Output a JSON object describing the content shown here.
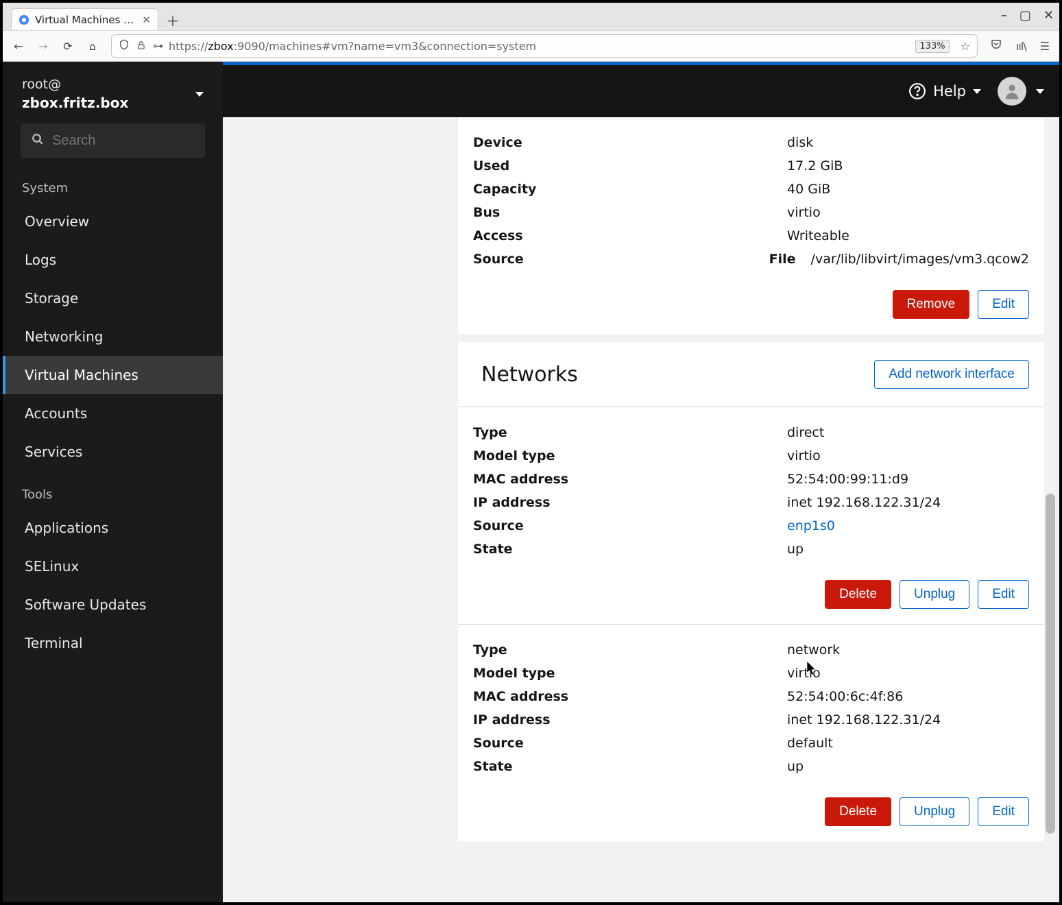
{
  "browser": {
    "tab_title": "Virtual Machines - root@",
    "url_prefix": "https://",
    "url_host": "zbox",
    "url_rest": ":9090/machines#vm?name=vm3&connection=system",
    "zoom": "133%"
  },
  "topbar": {
    "help": "Help"
  },
  "host": {
    "user": "root@",
    "name": "zbox.fritz.box"
  },
  "search": {
    "placeholder": "Search"
  },
  "nav": {
    "section_system": "System",
    "section_tools": "Tools",
    "items_system": [
      {
        "label": "Overview"
      },
      {
        "label": "Logs"
      },
      {
        "label": "Storage"
      },
      {
        "label": "Networking"
      },
      {
        "label": "Virtual Machines",
        "active": true
      },
      {
        "label": "Accounts"
      },
      {
        "label": "Services"
      }
    ],
    "items_tools": [
      {
        "label": "Applications"
      },
      {
        "label": "SELinux"
      },
      {
        "label": "Software Updates"
      },
      {
        "label": "Terminal"
      }
    ]
  },
  "disk_card": {
    "rows": [
      {
        "k": "Device",
        "v": "disk"
      },
      {
        "k": "Used",
        "v": "17.2 GiB"
      },
      {
        "k": "Capacity",
        "v": "40 GiB"
      },
      {
        "k": "Bus",
        "v": "virtio"
      },
      {
        "k": "Access",
        "v": "Writeable"
      },
      {
        "k": "Source",
        "sub_label": "File",
        "sub_value": "/var/lib/libvirt/images/vm3.qcow2"
      }
    ],
    "remove": "Remove",
    "edit": "Edit"
  },
  "networks": {
    "title": "Networks",
    "add": "Add network interface",
    "nics": [
      {
        "rows": [
          {
            "k": "Type",
            "v": "direct"
          },
          {
            "k": "Model type",
            "v": "virtio"
          },
          {
            "k": "MAC address",
            "v": "52:54:00:99:11:d9"
          },
          {
            "k": "IP address",
            "v": "inet 192.168.122.31/24"
          },
          {
            "k": "Source",
            "v": "enp1s0",
            "link": true
          },
          {
            "k": "State",
            "v": "up"
          }
        ]
      },
      {
        "rows": [
          {
            "k": "Type",
            "v": "network"
          },
          {
            "k": "Model type",
            "v": "virtio"
          },
          {
            "k": "MAC address",
            "v": "52:54:00:6c:4f:86"
          },
          {
            "k": "IP address",
            "v": "inet 192.168.122.31/24"
          },
          {
            "k": "Source",
            "v": "default"
          },
          {
            "k": "State",
            "v": "up"
          }
        ]
      }
    ],
    "delete": "Delete",
    "unplug": "Unplug",
    "edit": "Edit"
  }
}
